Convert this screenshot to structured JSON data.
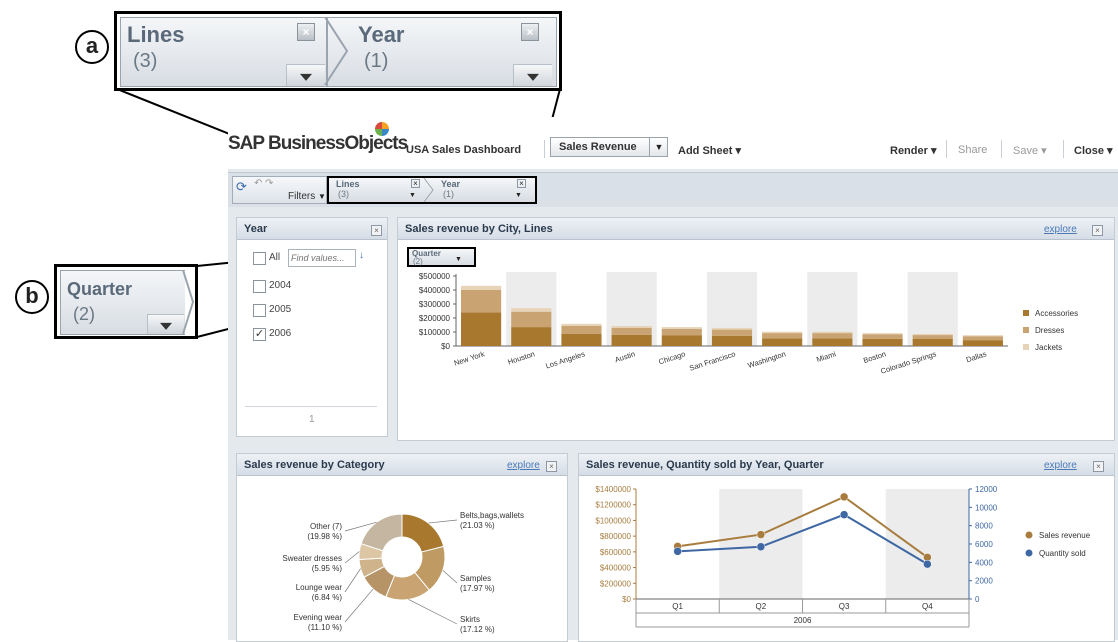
{
  "callouts": {
    "a": {
      "marker": "a",
      "chips": [
        {
          "title": "Lines",
          "count": "(3)"
        },
        {
          "title": "Year",
          "count": "(1)"
        }
      ]
    },
    "b": {
      "marker": "b",
      "chip": {
        "title": "Quarter",
        "count": "(2)"
      }
    }
  },
  "app": {
    "brand": "SAP BusinessObjects",
    "doc_title": "USA Sales Dashboard",
    "sheet_select": "Sales Revenue",
    "add_sheet": "Add Sheet",
    "render": "Render",
    "share": "Share",
    "save": "Save",
    "close": "Close",
    "filters_label": "Filters",
    "filter_chips": [
      {
        "title": "Lines",
        "count": "(3)"
      },
      {
        "title": "Year",
        "count": "(1)"
      }
    ]
  },
  "year_panel": {
    "title": "Year",
    "all_label": "All",
    "search_placeholder": "Find values...",
    "items": [
      {
        "label": "2004",
        "checked": false
      },
      {
        "label": "2005",
        "checked": false
      },
      {
        "label": "2006",
        "checked": true
      }
    ],
    "checkmark": "✓",
    "page": "1"
  },
  "city_panel": {
    "title": "Sales revenue by City, Lines",
    "explore": "explore",
    "quarter_chip": {
      "title": "Quarter",
      "count": "(2)"
    }
  },
  "category_panel": {
    "title": "Sales revenue by Category",
    "explore": "explore"
  },
  "yq_panel": {
    "title": "Sales revenue, Quantity sold by Year, Quarter",
    "explore": "explore"
  },
  "colors": {
    "accessories": "#a9782f",
    "dresses": "#c9a472",
    "jackets": "#e7d3b8",
    "sales_line": "#a87c3e",
    "qty_line": "#3e67a3"
  },
  "chart_data": [
    {
      "type": "bar",
      "title": "Sales revenue by City, Lines",
      "stacked": true,
      "categories": [
        "New York",
        "Houston",
        "Los Angeles",
        "Austin",
        "Chicago",
        "San Francisco",
        "Washington",
        "Miami",
        "Boston",
        "Colorado Springs",
        "Dallas"
      ],
      "series": [
        {
          "name": "Accessories",
          "values": [
            240000,
            135000,
            88000,
            80000,
            75000,
            72000,
            55000,
            55000,
            52000,
            50000,
            42000
          ]
        },
        {
          "name": "Dresses",
          "values": [
            160000,
            110000,
            55000,
            50000,
            48000,
            45000,
            37000,
            37000,
            32000,
            28000,
            28000
          ]
        },
        {
          "name": "Jackets",
          "values": [
            30000,
            25000,
            15000,
            13000,
            12000,
            12000,
            10000,
            10000,
            8000,
            8000,
            7000
          ]
        }
      ],
      "yticks": [
        "$500000",
        "$400000",
        "$300000",
        "$200000",
        "$100000",
        "$0"
      ],
      "ylim": [
        0,
        500000
      ],
      "legend": "right"
    },
    {
      "type": "pie",
      "donut": true,
      "title": "Sales revenue by Category",
      "slices": [
        {
          "label": "Belts,bags,wallets",
          "pct_label": "(21.03 %)",
          "value": 21.03,
          "color": "#a9782f"
        },
        {
          "label": "Samples",
          "pct_label": "(17.97 %)",
          "value": 17.97,
          "color": "#bf9a62"
        },
        {
          "label": "Skirts",
          "pct_label": "(17.12 %)",
          "value": 17.12,
          "color": "#c9a472"
        },
        {
          "label": "Evening wear",
          "pct_label": "(11.10 %)",
          "value": 11.1,
          "color": "#b79467"
        },
        {
          "label": "Lounge wear",
          "pct_label": "(6.84 %)",
          "value": 6.84,
          "color": "#cfb38a"
        },
        {
          "label": "Sweater dresses",
          "pct_label": "(5.95 %)",
          "value": 5.95,
          "color": "#dcc6a4"
        },
        {
          "label": "Other (7)",
          "pct_label": "(19.98 %)",
          "value": 19.98,
          "color": "#c4b6a0"
        }
      ]
    },
    {
      "type": "line",
      "title": "Sales revenue, Quantity sold by Year, Quarter",
      "categories": [
        "Q1",
        "Q2",
        "Q3",
        "Q4"
      ],
      "group_label": "2006",
      "series": [
        {
          "name": "Sales revenue",
          "axis": "left",
          "values": [
            670000,
            820000,
            1300000,
            530000
          ]
        },
        {
          "name": "Quantity sold",
          "axis": "right",
          "values": [
            5200,
            5700,
            9200,
            3800
          ]
        }
      ],
      "yticks_left": [
        "$1400000",
        "$1200000",
        "$1000000",
        "$800000",
        "$600000",
        "$400000",
        "$200000",
        "$0"
      ],
      "yticks_right": [
        "12000",
        "10000",
        "8000",
        "6000",
        "4000",
        "2000",
        "0"
      ],
      "ylim_left": [
        0,
        1400000
      ],
      "ylim_right": [
        0,
        12000
      ],
      "legend": "right"
    }
  ]
}
